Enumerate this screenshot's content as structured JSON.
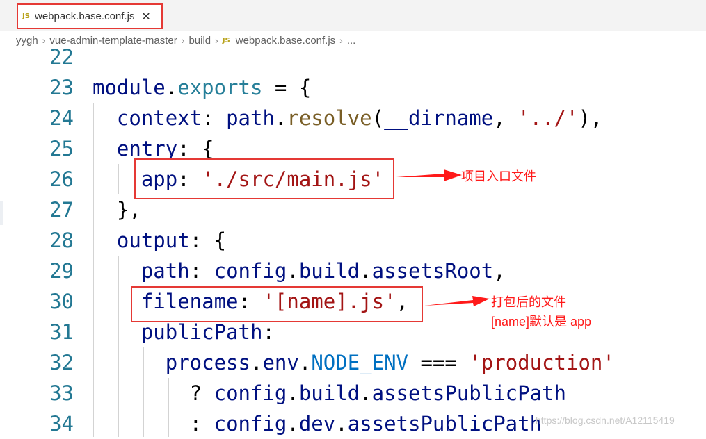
{
  "tab": {
    "badge": "JS",
    "title": "webpack.base.conf.js",
    "close": "✕"
  },
  "breadcrumb": {
    "items": [
      "yygh",
      "vue-admin-template-master",
      "build",
      "webpack.base.conf.js",
      "..."
    ],
    "separator": "›",
    "file_badge": "JS"
  },
  "code_lines": [
    {
      "num": "22",
      "tokens": []
    },
    {
      "num": "23",
      "tokens": [
        {
          "t": "module",
          "c": "prop"
        },
        {
          "t": ".",
          "c": "plain"
        },
        {
          "t": "exports",
          "c": "method"
        },
        {
          "t": " = {",
          "c": "plain"
        }
      ]
    },
    {
      "num": "24",
      "tokens": [
        {
          "t": "  context",
          "c": "prop"
        },
        {
          "t": ": ",
          "c": "plain"
        },
        {
          "t": "path",
          "c": "prop"
        },
        {
          "t": ".",
          "c": "plain"
        },
        {
          "t": "resolve",
          "c": "fn"
        },
        {
          "t": "(",
          "c": "plain"
        },
        {
          "t": "__dirname",
          "c": "prop"
        },
        {
          "t": ", ",
          "c": "plain"
        },
        {
          "t": "'../'",
          "c": "str"
        },
        {
          "t": "),",
          "c": "plain"
        }
      ]
    },
    {
      "num": "25",
      "tokens": [
        {
          "t": "  entry",
          "c": "prop"
        },
        {
          "t": ": {",
          "c": "plain"
        }
      ]
    },
    {
      "num": "26",
      "tokens": [
        {
          "t": "    app",
          "c": "prop"
        },
        {
          "t": ": ",
          "c": "plain"
        },
        {
          "t": "'./src/main.js'",
          "c": "str"
        }
      ]
    },
    {
      "num": "27",
      "tokens": [
        {
          "t": "  },",
          "c": "plain"
        }
      ]
    },
    {
      "num": "28",
      "tokens": [
        {
          "t": "  output",
          "c": "prop"
        },
        {
          "t": ": {",
          "c": "plain"
        }
      ]
    },
    {
      "num": "29",
      "tokens": [
        {
          "t": "    path",
          "c": "prop"
        },
        {
          "t": ": ",
          "c": "plain"
        },
        {
          "t": "config",
          "c": "prop"
        },
        {
          "t": ".",
          "c": "plain"
        },
        {
          "t": "build",
          "c": "prop"
        },
        {
          "t": ".",
          "c": "plain"
        },
        {
          "t": "assetsRoot",
          "c": "prop"
        },
        {
          "t": ",",
          "c": "plain"
        }
      ]
    },
    {
      "num": "30",
      "tokens": [
        {
          "t": "    filename",
          "c": "prop"
        },
        {
          "t": ": ",
          "c": "plain"
        },
        {
          "t": "'[name].js'",
          "c": "str"
        },
        {
          "t": ",",
          "c": "plain"
        }
      ]
    },
    {
      "num": "31",
      "tokens": [
        {
          "t": "    publicPath",
          "c": "prop"
        },
        {
          "t": ":",
          "c": "plain"
        }
      ]
    },
    {
      "num": "32",
      "tokens": [
        {
          "t": "      process",
          "c": "prop"
        },
        {
          "t": ".",
          "c": "plain"
        },
        {
          "t": "env",
          "c": "prop"
        },
        {
          "t": ".",
          "c": "plain"
        },
        {
          "t": "NODE_ENV",
          "c": "const"
        },
        {
          "t": " === ",
          "c": "plain"
        },
        {
          "t": "'production'",
          "c": "str"
        }
      ]
    },
    {
      "num": "33",
      "tokens": [
        {
          "t": "        ? ",
          "c": "plain"
        },
        {
          "t": "config",
          "c": "prop"
        },
        {
          "t": ".",
          "c": "plain"
        },
        {
          "t": "build",
          "c": "prop"
        },
        {
          "t": ".",
          "c": "plain"
        },
        {
          "t": "assetsPublicPath",
          "c": "prop"
        }
      ]
    },
    {
      "num": "34",
      "tokens": [
        {
          "t": "        : ",
          "c": "plain"
        },
        {
          "t": "config",
          "c": "prop"
        },
        {
          "t": ".",
          "c": "plain"
        },
        {
          "t": "dev",
          "c": "prop"
        },
        {
          "t": ".",
          "c": "plain"
        },
        {
          "t": "assetsPublicPath",
          "c": "prop"
        }
      ]
    }
  ],
  "annotations": {
    "entry_note": "项目入口文件",
    "output_note_line1": "打包后的文件",
    "output_note_line2": "[name]默认是 app"
  },
  "watermark": "https://blog.csdn.net/A12115419",
  "colors": {
    "highlight": "#e53935",
    "annotation": "#ff1a1a",
    "line_number": "#237893",
    "property": "#001080",
    "function": "#795e26",
    "string": "#a31515",
    "constant": "#0070c1",
    "method": "#267f99"
  }
}
